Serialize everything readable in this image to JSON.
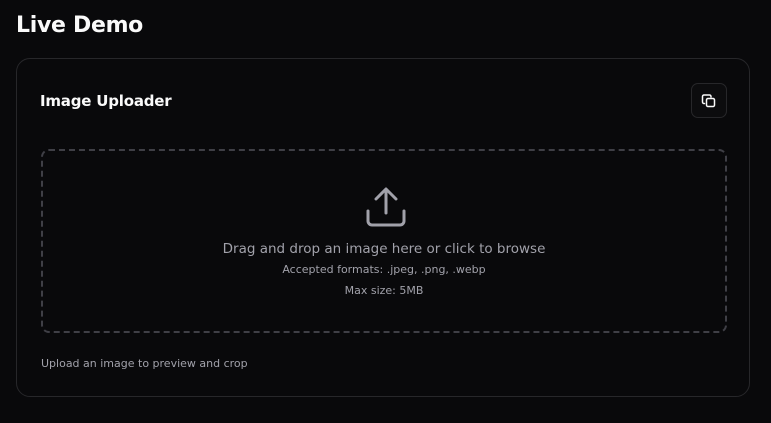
{
  "page": {
    "title": "Live Demo"
  },
  "card": {
    "title": "Image Uploader",
    "copy_button_icon": "copy-icon",
    "dropzone": {
      "icon": "upload-icon",
      "primary_text": "Drag and drop an image here or click to browse",
      "formats_text": "Accepted formats: .jpeg, .png, .webp",
      "max_size_text": "Max size: 5MB"
    },
    "hint": "Upload an image to preview and crop"
  },
  "colors": {
    "background": "#09090b",
    "border": "#27272a",
    "dashed_border": "#3f3f46",
    "text_primary": "#fafafa",
    "text_muted": "#a1a1aa"
  }
}
